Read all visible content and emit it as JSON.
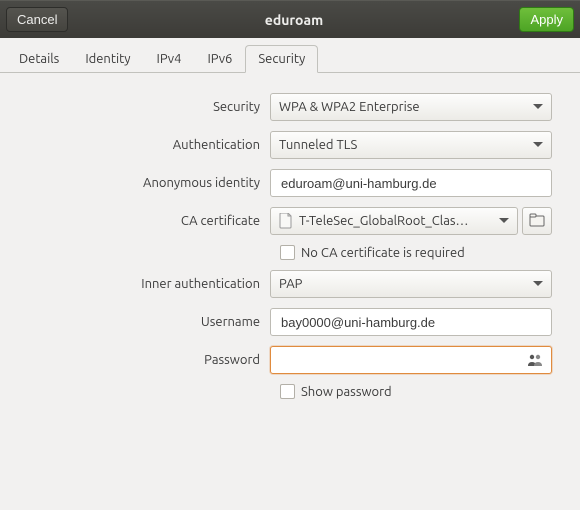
{
  "titlebar": {
    "cancel": "Cancel",
    "title": "eduroam",
    "apply": "Apply"
  },
  "tabs": {
    "details": "Details",
    "identity": "Identity",
    "ipv4": "IPv4",
    "ipv6": "IPv6",
    "security": "Security"
  },
  "labels": {
    "security": "Security",
    "authentication": "Authentication",
    "anonymous_identity": "Anonymous identity",
    "ca_certificate": "CA certificate",
    "no_ca_required": "No CA certificate is required",
    "inner_authentication": "Inner authentication",
    "username": "Username",
    "password": "Password",
    "show_password": "Show password"
  },
  "values": {
    "security": "WPA & WPA2 Enterprise",
    "authentication": "Tunneled TLS",
    "anonymous_identity": "eduroam@uni-hamburg.de",
    "ca_certificate": "T-TeleSec_GlobalRoot_Clas…",
    "inner_authentication": "PAP",
    "username": "bay0000@uni-hamburg.de",
    "password": ""
  }
}
